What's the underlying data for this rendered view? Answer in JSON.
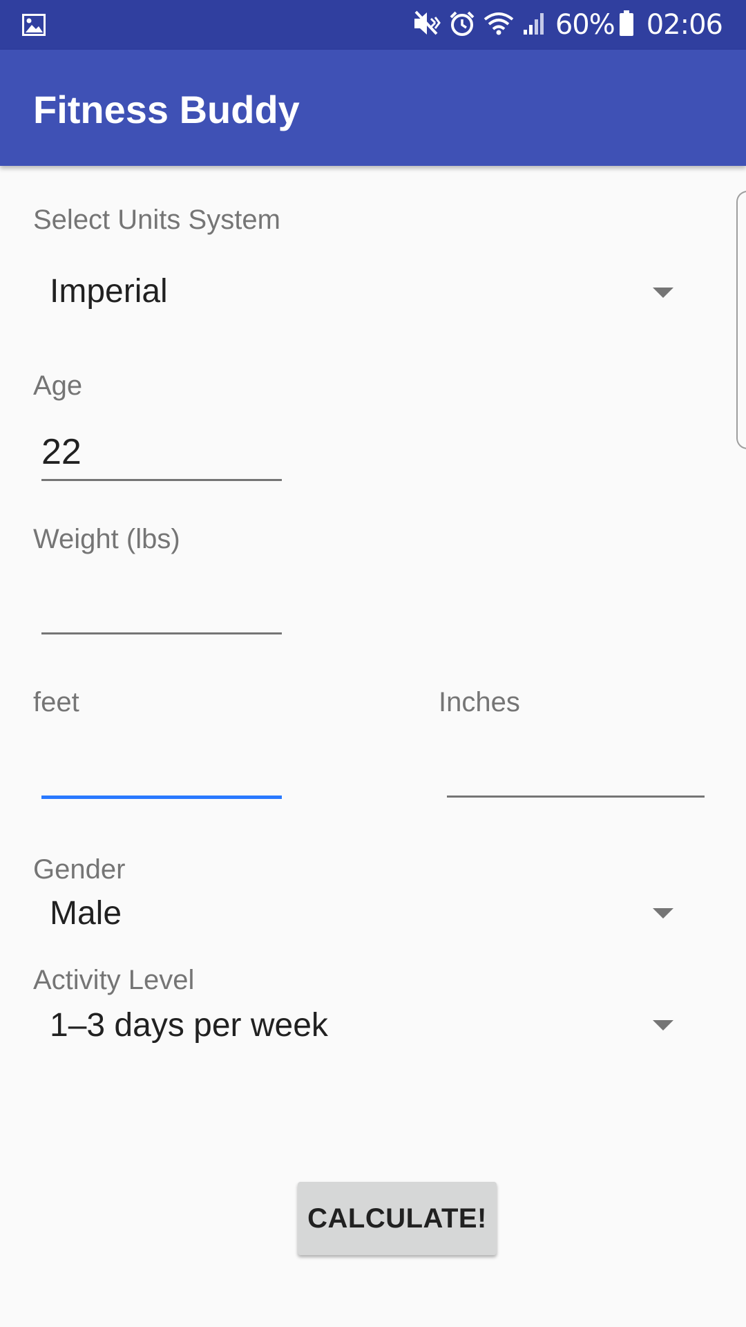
{
  "status_bar": {
    "battery_percent": "60%",
    "time": "02:06",
    "icons": [
      "gallery-notification-icon",
      "mute-icon",
      "alarm-icon",
      "wifi-icon",
      "signal-icon",
      "battery-icon"
    ]
  },
  "app_bar": {
    "title": "Fitness Buddy"
  },
  "form": {
    "units": {
      "label": "Select Units System",
      "value": "Imperial"
    },
    "age": {
      "label": "Age",
      "value": "22"
    },
    "weight": {
      "label": "Weight (lbs)",
      "value": ""
    },
    "feet": {
      "label": "feet",
      "value": ""
    },
    "inches": {
      "label": "Inches",
      "value": ""
    },
    "gender": {
      "label": "Gender",
      "value": "Male"
    },
    "activity": {
      "label": "Activity Level",
      "value": "1–3 days per week"
    }
  },
  "calculate_button": {
    "label": "CALCULATE!"
  },
  "colors": {
    "status_bar": "#303f9f",
    "app_bar": "#3f51b5",
    "focus_underline": "#2979ff",
    "button": "#d6d7d7"
  }
}
